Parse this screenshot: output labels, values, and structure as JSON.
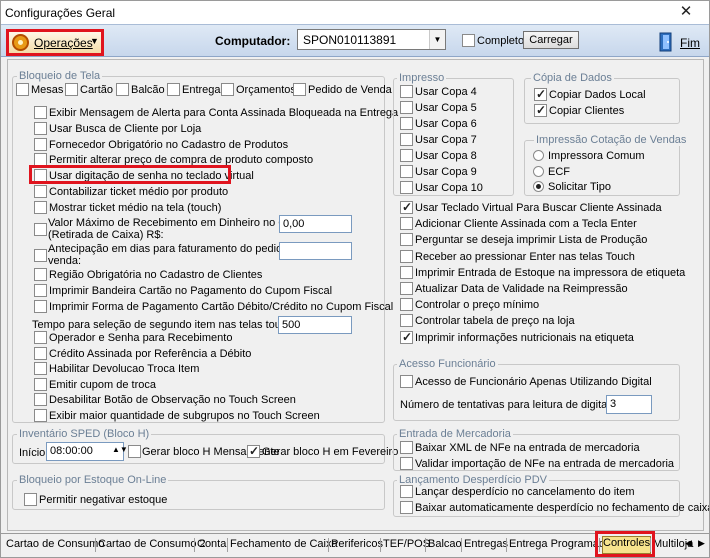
{
  "window": {
    "title": "Configurações Geral",
    "close_glyph": "✕"
  },
  "toolbar": {
    "operations_label": "Operações",
    "computer_label": "Computador:",
    "computer_value": "SPON010113891",
    "complete_label": "Completo",
    "load_label": "Carregar",
    "exit_label": "Fim"
  },
  "screen_lock": {
    "title": "Bloqueio de Tela",
    "modes": [
      {
        "label": "Mesas",
        "checked": false
      },
      {
        "label": "Cartão",
        "checked": false
      },
      {
        "label": "Balcão",
        "checked": false
      },
      {
        "label": "Entrega",
        "checked": false
      },
      {
        "label": "Orçamentos",
        "checked": false
      },
      {
        "label": "Pedido de Venda",
        "checked": false
      }
    ]
  },
  "left_options": [
    {
      "label": "Exibir Mensagem de Alerta para Conta Assinada Bloqueada na Entrega",
      "checked": false
    },
    {
      "label": "Usar Busca de Cliente por Loja",
      "checked": false
    },
    {
      "label": "Fornecedor Obrigatório no Cadastro de Produtos",
      "checked": false
    },
    {
      "label": "Permitir alterar preço de compra de produto composto",
      "checked": false
    },
    {
      "label": "Usar digitação de senha no teclado virtual",
      "checked": false
    },
    {
      "label": "Contabilizar ticket médio por produto",
      "checked": false
    },
    {
      "label": "Mostrar ticket médio na tela (touch)",
      "checked": false
    }
  ],
  "max_receipt": {
    "label_1": "Valor Máximo de Recebimento em Dinheiro no Caixa",
    "label_2": "(Retirada de Caixa) R$:",
    "value": "0,00"
  },
  "anticipation": {
    "label_1": "Antecipação em dias para faturamento do pedido de",
    "label_2": "venda:",
    "value": ""
  },
  "left_options_2": [
    {
      "label": "Região Obrigatória no Cadastro de Clientes",
      "checked": false
    },
    {
      "label": "Imprimir Bandeira Cartão no Pagamento do Cupom Fiscal",
      "checked": false
    },
    {
      "label": "Imprimir Forma de Pagamento Cartão Débito/Crédito no Cupom Fiscal",
      "checked": false
    }
  ],
  "second_item_time": {
    "label": "Tempo para seleção de segundo item nas telas touch:",
    "value": "500"
  },
  "left_options_3": [
    {
      "label": "Operador e Senha para Recebimento",
      "checked": false
    },
    {
      "label": "Crédito Assinada por Referência a Débito",
      "checked": false
    },
    {
      "label": "Habilitar Devolucao Troca Item",
      "checked": false
    },
    {
      "label": "Emitir cupom de troca",
      "checked": false
    },
    {
      "label": "Desabilitar Botão de Observação no Touch Screen",
      "checked": false
    },
    {
      "label": "Exibir maior quantidade de subgrupos no Touch Screen",
      "checked": false
    }
  ],
  "sped": {
    "title": "Inventário SPED (Bloco H)",
    "start_label": "Início",
    "start_value": "08:00:00",
    "monthly_label": "Gerar bloco H Mensalmente",
    "monthly_checked": false,
    "february_label": "Gerar bloco H em Fevereiro",
    "february_checked": true
  },
  "stock_lock": {
    "title": "Bloqueio por Estoque On-Line",
    "negative_label": "Permitir negativar estoque",
    "negative_checked": false
  },
  "print": {
    "title": "Impresso",
    "copies": [
      "Usar Copa 4",
      "Usar Copa 5",
      "Usar Copa 6",
      "Usar Copa 7",
      "Usar Copa 8",
      "Usar Copa 9",
      "Usar Copa 10"
    ]
  },
  "data_copy": {
    "title": "Cópia de Dados",
    "items": [
      {
        "label": "Copiar Dados Local",
        "checked": true
      },
      {
        "label": "Copiar Clientes",
        "checked": true
      }
    ]
  },
  "sales_quote": {
    "title": "Impressão Cotação de Vendas",
    "options": [
      {
        "label": "Impressora Comum",
        "checked": false
      },
      {
        "label": "ECF",
        "checked": false
      },
      {
        "label": "Solicitar Tipo",
        "checked": true
      }
    ]
  },
  "right_options": [
    {
      "label": "Usar Teclado Virtual Para Buscar Cliente Assinada",
      "checked": true
    },
    {
      "label": "Adicionar Cliente Assinada com a Tecla Enter",
      "checked": false
    },
    {
      "label": "Perguntar se deseja imprimir Lista de Produção",
      "checked": false
    },
    {
      "label": "Receber ao pressionar Enter nas telas Touch",
      "checked": false
    },
    {
      "label": "Imprimir Entrada de Estoque na impressora de etiqueta",
      "checked": false
    },
    {
      "label": "Atualizar Data de Validade na Reimpressão",
      "checked": false
    },
    {
      "label": "Controlar o preço mínimo",
      "checked": false
    },
    {
      "label": "Controlar tabela de preço na loja",
      "checked": false
    },
    {
      "label": "Imprimir informações nutricionais na etiqueta",
      "checked": true
    }
  ],
  "employee_access": {
    "title": "Acesso Funcionário",
    "digital_label": "Acesso de Funcionário Apenas Utilizando Digital",
    "digital_checked": false,
    "attempts_label": "Número de tentativas para leitura de digital:",
    "attempts_value": "3"
  },
  "goods_entry": {
    "title": "Entrada de Mercadoria",
    "items": [
      {
        "label": "Baixar XML de NFe na entrada de mercadoria",
        "checked": false
      },
      {
        "label": "Validar importação de NFe na entrada de mercadoria",
        "checked": false
      }
    ]
  },
  "waste": {
    "title": "Lançamento Desperdício PDV",
    "items": [
      {
        "label": "Lançar desperdício no cancelamento do item",
        "checked": false
      },
      {
        "label": "Baixar automaticamente desperdício no fechamento de caixa",
        "checked": false
      }
    ]
  },
  "tabs": [
    "Cartao de Consumo",
    "Cartao de Consumo 2",
    "Conta",
    "Fechamento de Caixa",
    "Perifericos",
    "TEF/POS",
    "Balcao",
    "Entregas",
    "Entrega Programada",
    "Controles",
    "Multiloja"
  ],
  "selected_tab": "Controles"
}
